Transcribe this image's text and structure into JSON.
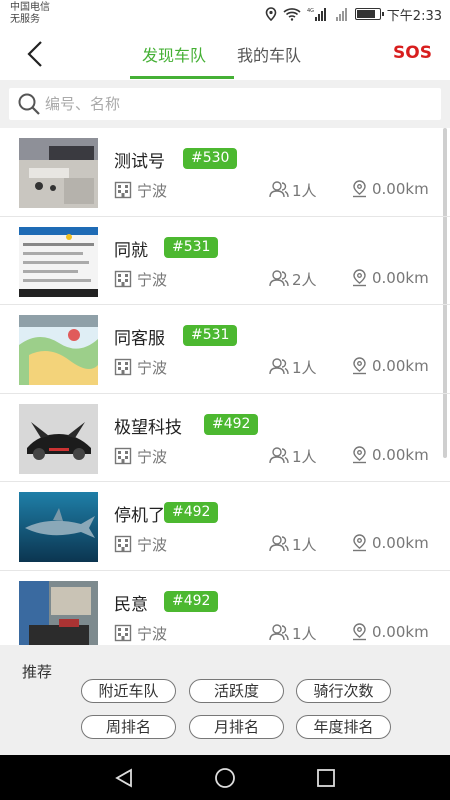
{
  "status_bar": {
    "carrier_line1": "中国电信",
    "carrier_line2": "无服务",
    "network": "4G",
    "battery_level": 0.85,
    "time": "下午2:33"
  },
  "header": {
    "tabs": [
      {
        "label": "发现车队",
        "active": true
      },
      {
        "label": "我的车队",
        "active": false
      }
    ],
    "sos_label": "SOS",
    "accent_color": "#45b035",
    "sos_color": "#d81e1e"
  },
  "search": {
    "placeholder": "编号、名称"
  },
  "teams": [
    {
      "name": "测试号",
      "id": "#530",
      "city": "宁波",
      "members": "1人",
      "distance": "0.00km",
      "thumb": "photo-desk"
    },
    {
      "name": "同就",
      "id": "#531",
      "city": "宁波",
      "members": "2人",
      "distance": "0.00km",
      "thumb": "screenshot-list"
    },
    {
      "name": "同客服",
      "id": "#531",
      "city": "宁波",
      "members": "1人",
      "distance": "0.00km",
      "thumb": "illustration-map"
    },
    {
      "name": "极望科技",
      "id": "#492",
      "city": "宁波",
      "members": "1人",
      "distance": "0.00km",
      "thumb": "black-sportscar"
    },
    {
      "name": "停机了",
      "id": "#492",
      "city": "宁波",
      "members": "1人",
      "distance": "0.00km",
      "thumb": "shark-underwater"
    },
    {
      "name": "民意",
      "id": "#492",
      "city": "宁波",
      "members": "1人",
      "distance": "0.00km",
      "thumb": "photo-room"
    }
  ],
  "recommend": {
    "title": "推荐",
    "chips": [
      "附近车队",
      "活跃度",
      "骑行次数",
      "周排名",
      "月排名",
      "年度排名"
    ]
  },
  "nav": {
    "icons": [
      "back-triangle-icon",
      "home-circle-icon",
      "recent-square-icon"
    ]
  }
}
